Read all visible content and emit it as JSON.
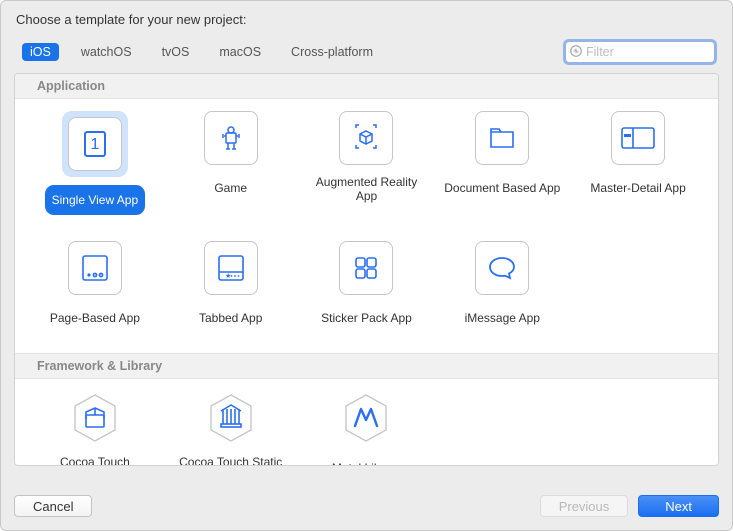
{
  "title": "Choose a template for your new project:",
  "tabs": {
    "ios": "iOS",
    "watchos": "watchOS",
    "tvos": "tvOS",
    "macos": "macOS",
    "cross": "Cross-platform"
  },
  "selected_tab": "ios",
  "search": {
    "placeholder": "Filter"
  },
  "sections": {
    "application": "Application",
    "framework": "Framework & Library"
  },
  "templates": {
    "single_view": "Single View App",
    "game": "Game",
    "ar": "Augmented Reality App",
    "document": "Document Based App",
    "master_detail": "Master-Detail App",
    "page_based": "Page-Based App",
    "tabbed": "Tabbed App",
    "sticker": "Sticker Pack App",
    "imessage": "iMessage App",
    "cocoa_fw": "Cocoa Touch Framework",
    "cocoa_static": "Cocoa Touch Static Library",
    "metal": "Metal Library"
  },
  "selected_template": "single_view",
  "buttons": {
    "cancel": "Cancel",
    "previous": "Previous",
    "next": "Next"
  },
  "colors": {
    "accent": "#1a73e8",
    "icon": "#2b6ef2"
  }
}
